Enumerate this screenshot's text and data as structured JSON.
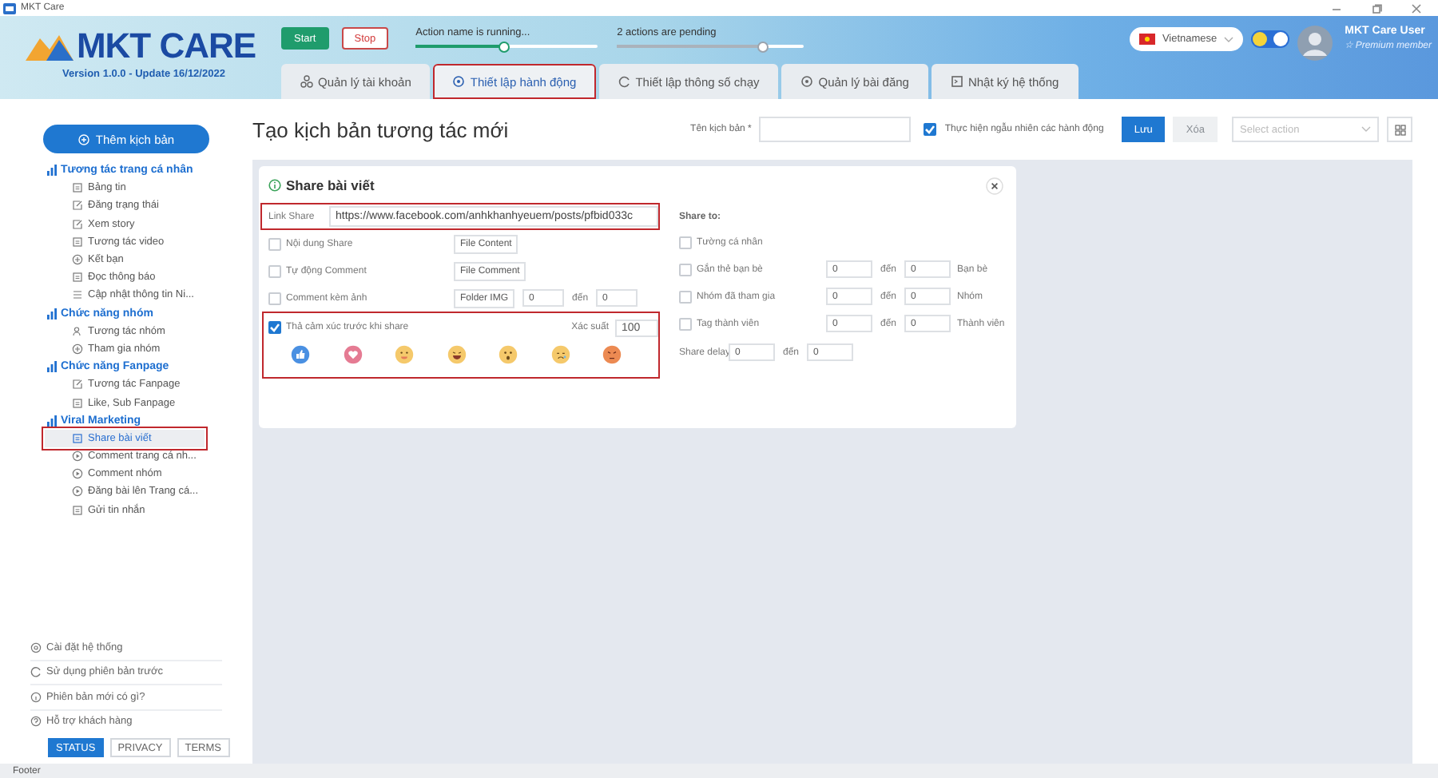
{
  "window": {
    "title": "MKT Care"
  },
  "header": {
    "logo": "MKT CARE",
    "version": "Version 1.0.0 - Update 16/12/2022",
    "buttons": [
      {
        "label": "Start",
        "kind": "primary"
      },
      {
        "label": "Stop",
        "kind": "outline"
      }
    ],
    "progress": [
      {
        "label": "Action name is running...",
        "level": 0.49
      },
      {
        "label": "2 actions are pending",
        "level": 0.78
      }
    ],
    "language": "Vietnamese",
    "theme_toggle": {
      "on": true
    },
    "user": {
      "name": "MKT Care User",
      "badge": "☆ Premium member"
    }
  },
  "tabs": [
    {
      "label": "Quản lý tài khoản",
      "selected": false,
      "highlighted": false
    },
    {
      "label": "Thiết lập hành động",
      "selected": true,
      "highlighted": true
    },
    {
      "label": "Thiết lập thông số chạy",
      "selected": false,
      "highlighted": false
    },
    {
      "label": "Quản lý bài đăng",
      "selected": false,
      "highlighted": false
    },
    {
      "label": "Nhật ký hệ thống",
      "selected": false,
      "highlighted": false
    }
  ],
  "sidebar": {
    "add_button": "Thêm kịch bản",
    "groups": [
      {
        "label": "Tương tác trang cá nhân",
        "children": [
          {
            "label": "Bảng tin",
            "selected": false,
            "highlighted": false
          },
          {
            "label": "Đăng trạng thái",
            "selected": false,
            "highlighted": false
          },
          {
            "label": "Xem story",
            "selected": false,
            "highlighted": false
          },
          {
            "label": "Tương tác video",
            "selected": false,
            "highlighted": false
          },
          {
            "label": "Kết bạn",
            "selected": false,
            "highlighted": false
          },
          {
            "label": "Đọc thông báo",
            "selected": false,
            "highlighted": false
          },
          {
            "label": "Cập nhật thông tin Ni...",
            "selected": false,
            "highlighted": false
          }
        ]
      },
      {
        "label": "Chức năng nhóm",
        "children": [
          {
            "label": "Tương tác nhóm",
            "selected": false,
            "highlighted": false
          },
          {
            "label": "Tham gia nhóm",
            "selected": false,
            "highlighted": false
          }
        ]
      },
      {
        "label": "Chức năng Fanpage",
        "children": [
          {
            "label": "Tương tác Fanpage",
            "selected": false,
            "highlighted": false
          },
          {
            "label": "Like, Sub Fanpage",
            "selected": false,
            "highlighted": false
          }
        ]
      },
      {
        "label": "Viral Marketing",
        "children": [
          {
            "label": "Share bài viết",
            "selected": true,
            "highlighted": true
          },
          {
            "label": "Comment trang cá nh...",
            "selected": false,
            "highlighted": false
          },
          {
            "label": "Comment nhóm",
            "selected": false,
            "highlighted": false
          },
          {
            "label": "Đăng bài lên Trang cá...",
            "selected": false,
            "highlighted": false
          },
          {
            "label": "Gửi tin nhắn",
            "selected": false,
            "highlighted": false
          }
        ]
      }
    ],
    "links": [
      "Cài đặt hệ thống",
      "Sử dụng phiên bản trước",
      "Phiên bản mới có gì?",
      "Hỗ trợ khách hàng"
    ],
    "buttons": [
      {
        "label": "STATUS",
        "selected": true
      },
      {
        "label": "PRIVACY",
        "selected": false
      },
      {
        "label": "TERMS",
        "selected": false
      }
    ]
  },
  "main": {
    "title": "Tạo kịch bản tương tác mới",
    "name_label": "Tên kịch bản *",
    "random": {
      "label": "Thực hiện ngẫu nhiên các hành động",
      "checked": true
    },
    "save": {
      "label": "Lưu",
      "disabled": false
    },
    "delete": {
      "label": "Xóa",
      "disabled": true
    },
    "select_placeholder": "Select action",
    "card": {
      "title": "Share bài viết",
      "link": {
        "label": "Link Share",
        "value": "https://www.facebook.com/anhkhanhyeuem/posts/pfbid033c",
        "highlighted": true
      },
      "options": [
        {
          "label": "Nội dung Share",
          "checked": false,
          "button": "File Content"
        },
        {
          "label": "Tự động Comment",
          "checked": false,
          "button": "File Comment"
        },
        {
          "label": "Comment kèm ảnh",
          "checked": false,
          "button": "Folder IMG",
          "from": "0",
          "to_label": "đến",
          "to": "0"
        }
      ],
      "reactions": {
        "label": "Thả cảm xúc trước khi share",
        "checked": true,
        "probability_label": "Xác suất",
        "probability": "100",
        "highlighted": true
      },
      "share_to": {
        "title": "Share to:",
        "rows": [
          {
            "label": "Tường cá nhân",
            "checked": false
          },
          {
            "label": "Gắn thẻ bạn bè",
            "checked": false,
            "from": "0",
            "to_label": "đến",
            "to": "0",
            "unit": "Bạn bè"
          },
          {
            "label": "Nhóm đã tham gia",
            "checked": false,
            "from": "0",
            "to_label": "đến",
            "to": "0",
            "unit": "Nhóm"
          },
          {
            "label": "Tag thành viên",
            "checked": false,
            "from": "0",
            "to_label": "đến",
            "to": "0",
            "unit": "Thành viên"
          }
        ]
      },
      "delay": {
        "label": "Share delay",
        "from": "0",
        "to_label": "đến",
        "to": "0"
      }
    }
  },
  "footer": "Footer"
}
